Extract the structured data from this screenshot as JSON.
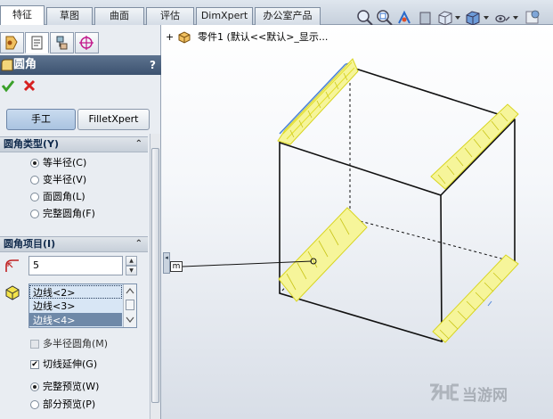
{
  "tabs": [
    {
      "label": "特征",
      "active": true
    },
    {
      "label": "草图",
      "active": false
    },
    {
      "label": "曲面",
      "active": false
    },
    {
      "label": "评估",
      "active": false
    },
    {
      "label": "DimXpert",
      "active": false
    },
    {
      "label": "办公室产品",
      "active": false
    }
  ],
  "view_toolbar": {
    "icons": [
      "zoom-to-fit-icon",
      "zoom-to-area-icon",
      "previous-view-icon",
      "section-view-icon",
      "view-orientation-icon",
      "display-style-icon",
      "hide-show-items-icon"
    ]
  },
  "property_manager": {
    "tab_icons": [
      "feature-manager-icon",
      "property-manager-icon",
      "configuration-manager-icon",
      "dimxpert-manager-icon"
    ],
    "title": "圆角",
    "help": "?",
    "ok_icon": "check-icon",
    "cancel_icon": "close-icon",
    "modes": {
      "manual": "手工",
      "filletxpert": "FilletXpert",
      "active": "manual"
    },
    "fillet_type": {
      "heading": "圆角类型(Y)",
      "options": [
        {
          "label": "等半径(C)",
          "selected": true
        },
        {
          "label": "变半径(V)",
          "selected": false
        },
        {
          "label": "面圆角(L)",
          "selected": false
        },
        {
          "label": "完整圆角(F)",
          "selected": false
        }
      ]
    },
    "fillet_items": {
      "heading": "圆角项目(I)",
      "radius_value": "5",
      "edges": [
        "边线<2>",
        "边线<3>",
        "边线<4>"
      ],
      "selected_edge": 2,
      "multi_radius": {
        "label": "多半径圆角(M)",
        "checked": false,
        "enabled": false
      },
      "tangent_propagation": {
        "label": "切线延伸(G)",
        "checked": true
      },
      "preview": [
        {
          "label": "完整预览(W)",
          "selected": true
        },
        {
          "label": "部分预览(P)",
          "selected": false
        }
      ]
    }
  },
  "graphics": {
    "tree_item": "零件1 (默认<<默认>_显示...",
    "callout_label": "m",
    "accent_highlight": "#f2f24a",
    "edge_blue": "#4f86d8"
  },
  "watermark": {
    "text": "当游网"
  }
}
